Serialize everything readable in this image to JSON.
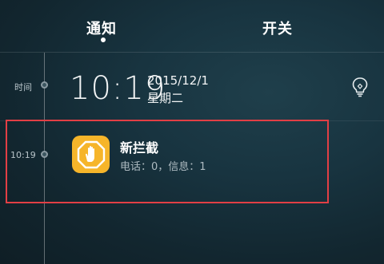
{
  "tabs": [
    {
      "label": "通知",
      "active": true
    },
    {
      "label": "开关",
      "active": false
    }
  ],
  "timeline": {
    "time_label": "时间",
    "clock": "10:19",
    "date": "2015/12/1",
    "weekday": "星期二"
  },
  "notification": {
    "time": "10:19",
    "title": "新拦截",
    "subtitle": "电话：0，信息：1",
    "icon": "hand-stop-octagon-icon",
    "icon_color": "#f6b52a"
  },
  "colors": {
    "background": "#183440",
    "highlight_border": "#e23f45"
  }
}
